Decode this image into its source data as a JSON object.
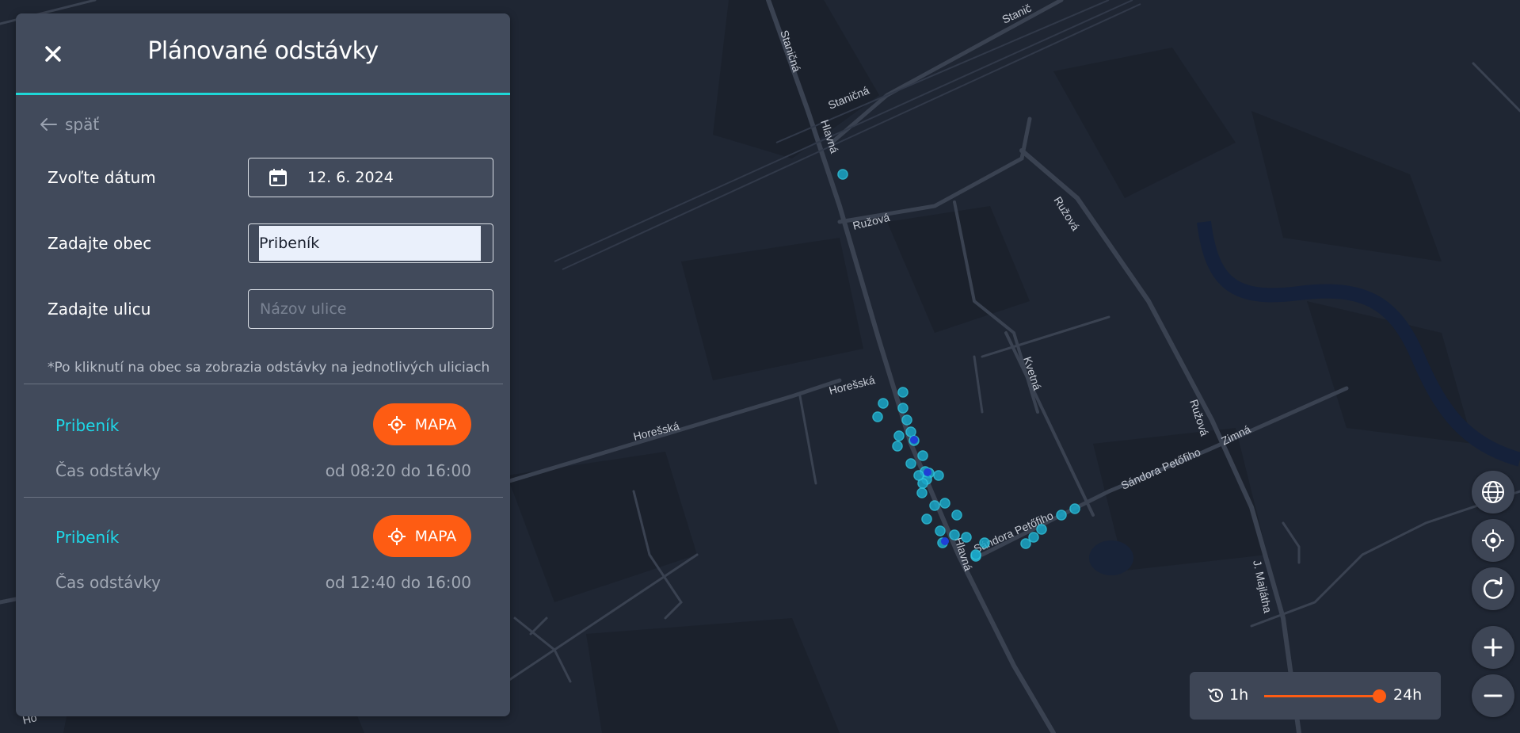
{
  "panel": {
    "title": "Plánované odstávky",
    "back_label": "späť",
    "date_label": "Zvoľte dátum",
    "date_value": "12. 6. 2024",
    "town_label": "Zadajte obec",
    "town_value": "Pribeník",
    "street_label": "Zadajte ulicu",
    "street_placeholder": "Názov ulice",
    "note": "*Po kliknutí na obec sa zobrazia odstávky na jednotlivých uliciach"
  },
  "results": [
    {
      "name": "Pribeník",
      "button": "MAPA",
      "time_label": "Čas odstávky",
      "time": "od 08:20 do 16:00"
    },
    {
      "name": "Pribeník",
      "button": "MAPA",
      "time_label": "Čas odstávky",
      "time": "od 12:40 do 16:00"
    }
  ],
  "map": {
    "street_labels": [
      "Staničná",
      "Staničná",
      "Stanič",
      "Hlavná",
      "Ružová",
      "Ružová",
      "Horešská",
      "Horešská",
      "Kvetná",
      "Ružová",
      "Zimná",
      "Sándora Petőfiho",
      "Sándora Petőfiho",
      "Hlavná",
      "J. Majlátha",
      "Ho"
    ],
    "controls": [
      "globe-icon",
      "locate-icon",
      "refresh-icon",
      "zoom-in-icon",
      "zoom-out-icon"
    ]
  },
  "timebar": {
    "min_label": "1h",
    "max_label": "24h",
    "value_fraction": 1.0
  },
  "colors": {
    "accent": "#fe5c13",
    "cyan": "#1ed8e8",
    "panel": "#414a5b",
    "map": "#1f2633"
  }
}
